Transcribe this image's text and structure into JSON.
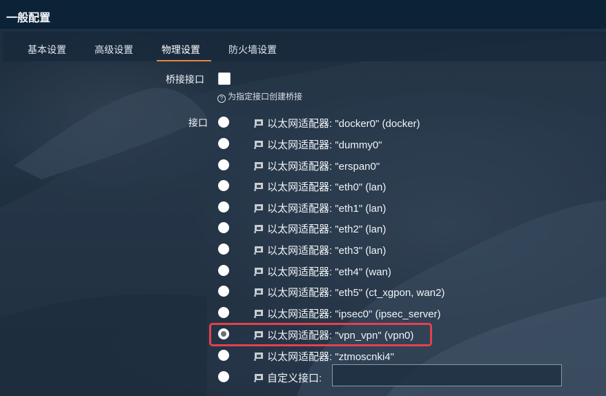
{
  "header": {
    "title": "一般配置"
  },
  "tabs": [
    {
      "label": "基本设置"
    },
    {
      "label": "高级设置"
    },
    {
      "label": "物理设置",
      "active": true
    },
    {
      "label": "防火墙设置"
    }
  ],
  "bridge": {
    "label": "桥接接口",
    "checked": false,
    "hint": "为指定接口创建桥接"
  },
  "interfaces": {
    "label": "接口",
    "selected_index": 10,
    "options": [
      "以太网适配器: \"docker0\" (docker)",
      "以太网适配器: \"dummy0\"",
      "以太网适配器: \"erspan0\"",
      "以太网适配器: \"eth0\" (lan)",
      "以太网适配器: \"eth1\" (lan)",
      "以太网适配器: \"eth2\" (lan)",
      "以太网适配器: \"eth3\" (lan)",
      "以太网适配器: \"eth4\" (wan)",
      "以太网适配器: \"eth5\" (ct_xgpon, wan2)",
      "以太网适配器: \"ipsec0\" (ipsec_server)",
      "以太网适配器: \"vpn_vpn\" (vpn0)",
      "以太网适配器: \"ztmoscnki4\""
    ],
    "custom_label": "自定义接口:",
    "custom_value": ""
  },
  "colors": {
    "accent": "#e8893a",
    "highlight_box": "#e5414e",
    "header_bg": "#0c2236"
  },
  "icons": {
    "network_adapter": "ethernet-port-icon",
    "hint": "question-circle-icon"
  }
}
